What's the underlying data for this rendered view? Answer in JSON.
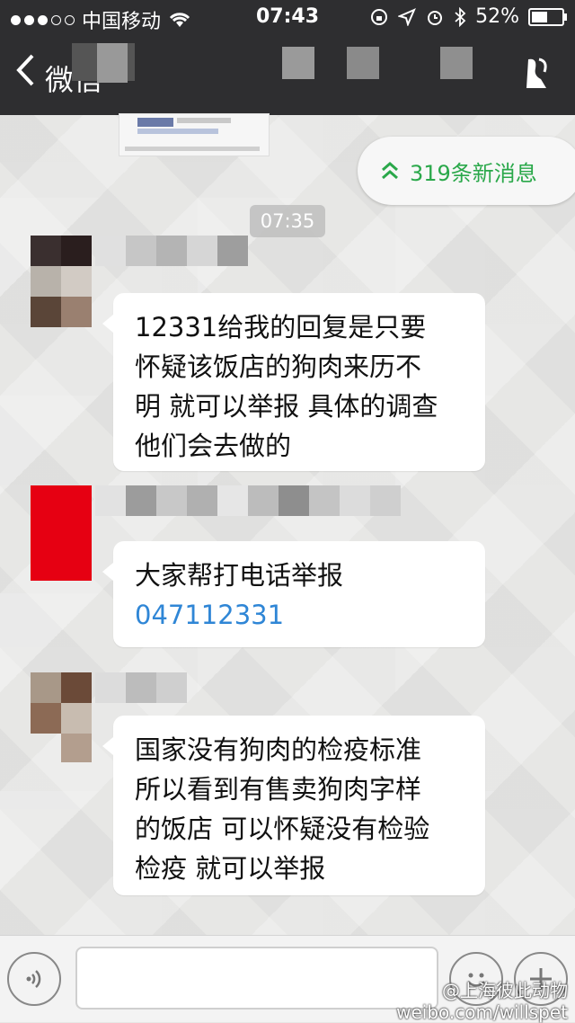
{
  "status_bar": {
    "carrier": "中国移动",
    "time": "07:43",
    "battery": "52%",
    "battery_level": 0.52
  },
  "nav": {
    "back_label": "微信",
    "back_icon": "chevron-left-icon",
    "profile_icon": "user-profile-icon"
  },
  "chat": {
    "new_messages": "319条新消息",
    "timestamp": "07:35",
    "messages": [
      {
        "lines": [
          "12331给我的回复是只要",
          "怀疑该饭店的狗肉来历不",
          "明 就可以举报 具体的调查",
          "他们会去做的"
        ]
      },
      {
        "lines": [
          "大家帮打电话举报"
        ],
        "phone": "047112331"
      },
      {
        "lines": [
          "国家没有狗肉的检疫标准",
          "所以看到有售卖狗肉字样",
          "的饭店 可以怀疑没有检验",
          "检疫 就可以举报"
        ]
      }
    ]
  },
  "input_bar": {
    "voice_icon": "voice-icon",
    "emoji_icon": "emoji-icon",
    "add_icon": "plus-icon"
  },
  "watermark": {
    "line1": "@上海彼此动物",
    "line2": "weibo.com/willspet"
  }
}
